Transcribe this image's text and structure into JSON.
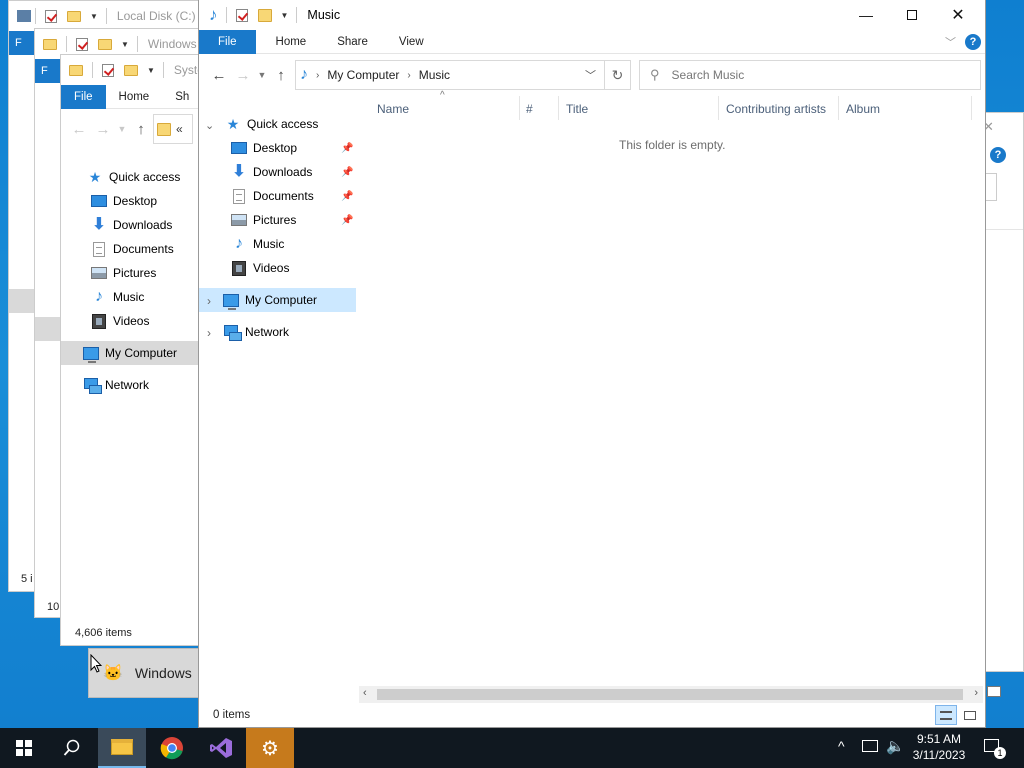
{
  "back_windows": {
    "w1": {
      "title": "Local Disk (C:)",
      "file_tab": "F",
      "status_partial": "5 i"
    },
    "w2": {
      "title": "Windows",
      "file_tab": "F",
      "status_partial": "10"
    },
    "w3": {
      "title": "Syster",
      "tabs": [
        "File",
        "Home",
        "Sh"
      ],
      "address_partial": "«",
      "nav": {
        "quick_access": "Quick access",
        "items": [
          "Desktop",
          "Downloads",
          "Documents",
          "Pictures",
          "Music",
          "Videos"
        ],
        "my_computer": "My Computer",
        "network": "Network"
      },
      "status": "4,606 items"
    }
  },
  "taskbar_preview": {
    "label": "Windows"
  },
  "main_window": {
    "title": "Music",
    "tabs": {
      "file": "File",
      "home": "Home",
      "share": "Share",
      "view": "View"
    },
    "breadcrumb": [
      "My Computer",
      "Music"
    ],
    "search_placeholder": "Search Music",
    "nav": {
      "quick_access": "Quick access",
      "items": [
        {
          "label": "Desktop",
          "icon": "desktop-icon",
          "pinned": true
        },
        {
          "label": "Downloads",
          "icon": "downloads-icon",
          "pinned": true
        },
        {
          "label": "Documents",
          "icon": "documents-icon",
          "pinned": true
        },
        {
          "label": "Pictures",
          "icon": "pictures-icon",
          "pinned": true
        },
        {
          "label": "Music",
          "icon": "music-icon",
          "pinned": false
        },
        {
          "label": "Videos",
          "icon": "videos-icon",
          "pinned": false
        }
      ],
      "my_computer": "My Computer",
      "network": "Network"
    },
    "columns": [
      "Name",
      "#",
      "Title",
      "Contributing artists",
      "Album"
    ],
    "empty_message": "This folder is empty.",
    "status": "0 items"
  },
  "taskbar": {
    "time": "9:51 AM",
    "date": "3/11/2023",
    "notification_count": "1"
  },
  "colors": {
    "accent": "#1979ca",
    "desktop": "#1586d4",
    "taskbar": "#101820",
    "selection": "#cce8ff"
  }
}
